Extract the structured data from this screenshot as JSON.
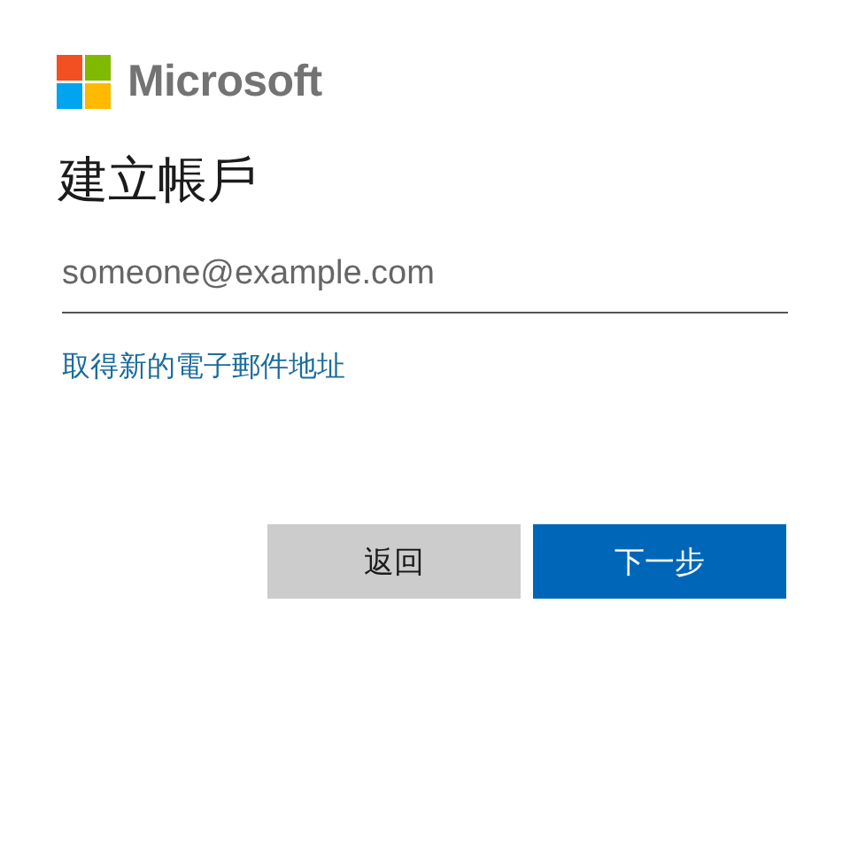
{
  "brand": {
    "name": "Microsoft"
  },
  "heading": "建立帳戶",
  "email_field": {
    "placeholder": "someone@example.com"
  },
  "link": "取得新的電子郵件地址",
  "buttons": [
    {
      "label": "返回",
      "kind": "secondary"
    },
    {
      "label": "下一步",
      "kind": "primary"
    }
  ]
}
